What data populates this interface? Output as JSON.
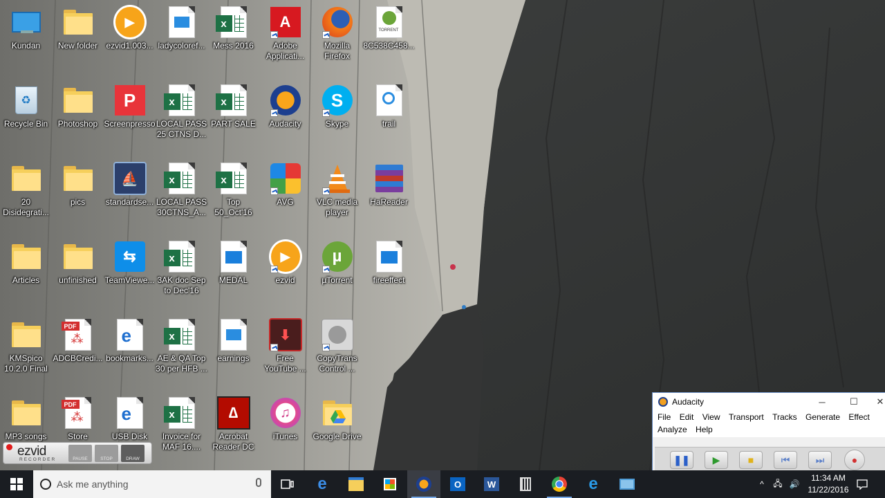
{
  "desktop": {
    "icons": [
      {
        "label": "Kundan",
        "icon": "computer-icon"
      },
      {
        "label": "New folder",
        "icon": "folder-icon"
      },
      {
        "label": "ezvid1.003...",
        "icon": "ezvid-icon"
      },
      {
        "label": "ladycoloref...",
        "icon": "image-file-icon"
      },
      {
        "label": "Mess 2016",
        "icon": "excel-file-icon"
      },
      {
        "label": "Adobe\nApplicati...",
        "icon": "adobe-icon"
      },
      {
        "label": "Mozilla\nFirefox",
        "icon": "firefox-icon"
      },
      {
        "label": "8C538C458...",
        "icon": "torrent-file-icon"
      },
      {
        "label": "Recycle Bin",
        "icon": "recycle-bin-icon"
      },
      {
        "label": "Photoshop",
        "icon": "folder-icon"
      },
      {
        "label": "Screenpresso",
        "icon": "screenpresso-icon"
      },
      {
        "label": "LOCAL PASS\n25 CTNS D...",
        "icon": "excel-file-icon"
      },
      {
        "label": "PART SALE",
        "icon": "excel-file-icon"
      },
      {
        "label": "Audacity",
        "icon": "audacity-icon"
      },
      {
        "label": "Skype",
        "icon": "skype-icon"
      },
      {
        "label": "trail",
        "icon": "media-file-icon"
      },
      {
        "label": "20\nDisidegrati...",
        "icon": "folder-icon"
      },
      {
        "label": "pics",
        "icon": "folder-icon"
      },
      {
        "label": "standardse...",
        "icon": "installer-icon"
      },
      {
        "label": "LOCAL PASS\n30CTNS_A...",
        "icon": "excel-file-icon"
      },
      {
        "label": "Top\n50_Oct'16",
        "icon": "excel-file-icon"
      },
      {
        "label": "AVG",
        "icon": "avg-icon"
      },
      {
        "label": "VLC media\nplayer",
        "icon": "vlc-icon"
      },
      {
        "label": "HaReader",
        "icon": "winrar-icon"
      },
      {
        "label": "Articles",
        "icon": "folder-icon"
      },
      {
        "label": "unfinished",
        "icon": "folder-icon"
      },
      {
        "label": "TeamViewe...",
        "icon": "teamviewer-icon"
      },
      {
        "label": "3AK doc Sep\nto Dec'16",
        "icon": "excel-file-icon"
      },
      {
        "label": "MEDAL",
        "icon": "video-file-icon"
      },
      {
        "label": "ezvid",
        "icon": "ezvid-icon"
      },
      {
        "label": "µTorrent",
        "icon": "utorrent-icon"
      },
      {
        "label": "fireeffect",
        "icon": "video-file-icon"
      },
      {
        "label": "KMSpico\n10.2.0 Final",
        "icon": "folder-icon"
      },
      {
        "label": "ADCBCredi...",
        "icon": "pdf-file-icon"
      },
      {
        "label": "bookmarks...",
        "icon": "edge-file-icon"
      },
      {
        "label": "AE & QA Top\n30 per HFB ...",
        "icon": "excel-file-icon"
      },
      {
        "label": "earnings",
        "icon": "image-file-icon"
      },
      {
        "label": "Free\nYouTube ...",
        "icon": "youtube-download-icon"
      },
      {
        "label": "CopyTrans\nControl ...",
        "icon": "copytrans-icon"
      },
      {
        "label": "MP3 songs",
        "icon": "folder-icon"
      },
      {
        "label": "Store",
        "icon": "pdf-file-icon"
      },
      {
        "label": "USB Disk",
        "icon": "edge-file-icon"
      },
      {
        "label": "Invoice for\nMAF 16....",
        "icon": "excel-file-icon"
      },
      {
        "label": "Acrobat\nReader DC",
        "icon": "acrobat-icon"
      },
      {
        "label": "iTunes",
        "icon": "itunes-icon"
      },
      {
        "label": "Google Drive",
        "icon": "google-drive-icon"
      }
    ]
  },
  "audacity": {
    "title": "Audacity",
    "menus": [
      "File",
      "Edit",
      "View",
      "Transport",
      "Tracks",
      "Generate",
      "Effect",
      "Analyze",
      "Help"
    ],
    "minimize": "─",
    "maximize": "☐",
    "close": "✕"
  },
  "ezvid": {
    "logo": "ezvid",
    "subtitle": "RECORDER",
    "buttons": [
      "PAUSE",
      "STOP",
      "DRAW"
    ]
  },
  "taskbar": {
    "search_placeholder": "Ask me anything",
    "apps": [
      "task-view-icon",
      "edge-icon",
      "file-explorer-icon",
      "store-icon",
      "audacity-icon",
      "outlook-icon",
      "word-icon",
      "calculator-icon",
      "chrome-icon",
      "internet-explorer-icon",
      "control-panel-icon"
    ],
    "clock_time": "11:34 AM",
    "clock_date": "11/22/2016",
    "colors": {
      "bar": "#1a1d22",
      "accent": "#76a9e8"
    }
  }
}
